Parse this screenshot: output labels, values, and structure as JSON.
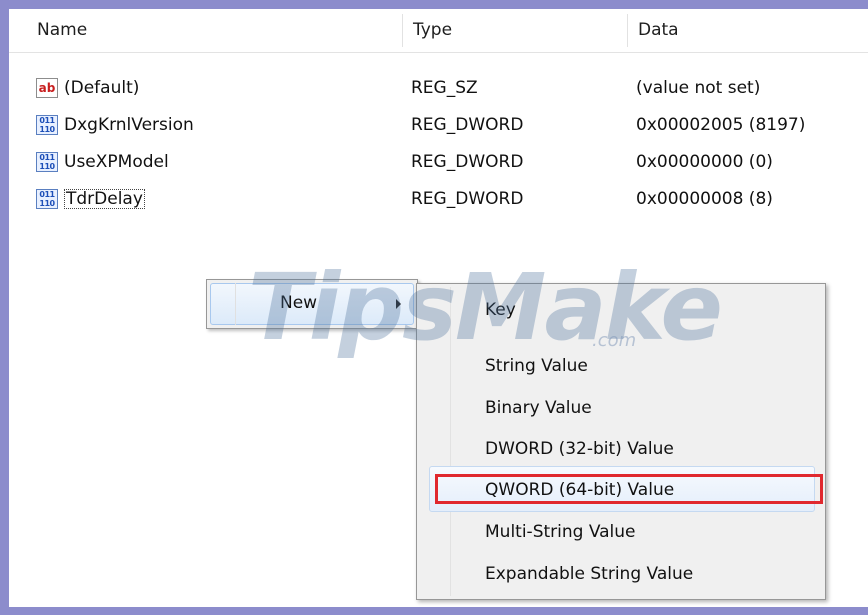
{
  "columns": {
    "name": "Name",
    "type": "Type",
    "data": "Data"
  },
  "rows": [
    {
      "icon": "string-value-icon",
      "icon_text": "ab",
      "name": "(Default)",
      "type": "REG_SZ",
      "data": "(value not set)"
    },
    {
      "icon": "binary-value-icon",
      "icon_text": "011 110",
      "name": "DxgKrnlVersion",
      "type": "REG_DWORD",
      "data": "0x00002005 (8197)"
    },
    {
      "icon": "binary-value-icon",
      "icon_text": "011 110",
      "name": "UseXPModel",
      "type": "REG_DWORD",
      "data": "0x00000000 (0)"
    },
    {
      "icon": "binary-value-icon",
      "icon_text": "011 110",
      "name": "TdrDelay",
      "type": "REG_DWORD",
      "data": "0x00000008 (8)"
    }
  ],
  "context_menu": {
    "label": "New",
    "submenu_arrow_icon": "chevron-right-icon"
  },
  "submenu": {
    "items": [
      "Key",
      "String Value",
      "Binary Value",
      "DWORD (32-bit) Value",
      "QWORD (64-bit) Value",
      "Multi-String Value",
      "Expandable String Value"
    ],
    "highlighted_item": "QWORD (64-bit) Value"
  },
  "watermark": {
    "main": "TipsMake",
    "suffix": ".com"
  },
  "colors": {
    "highlight_box": "#e0282e",
    "menu_background": "#f0f0f0",
    "frame": "#8c8ccc"
  }
}
